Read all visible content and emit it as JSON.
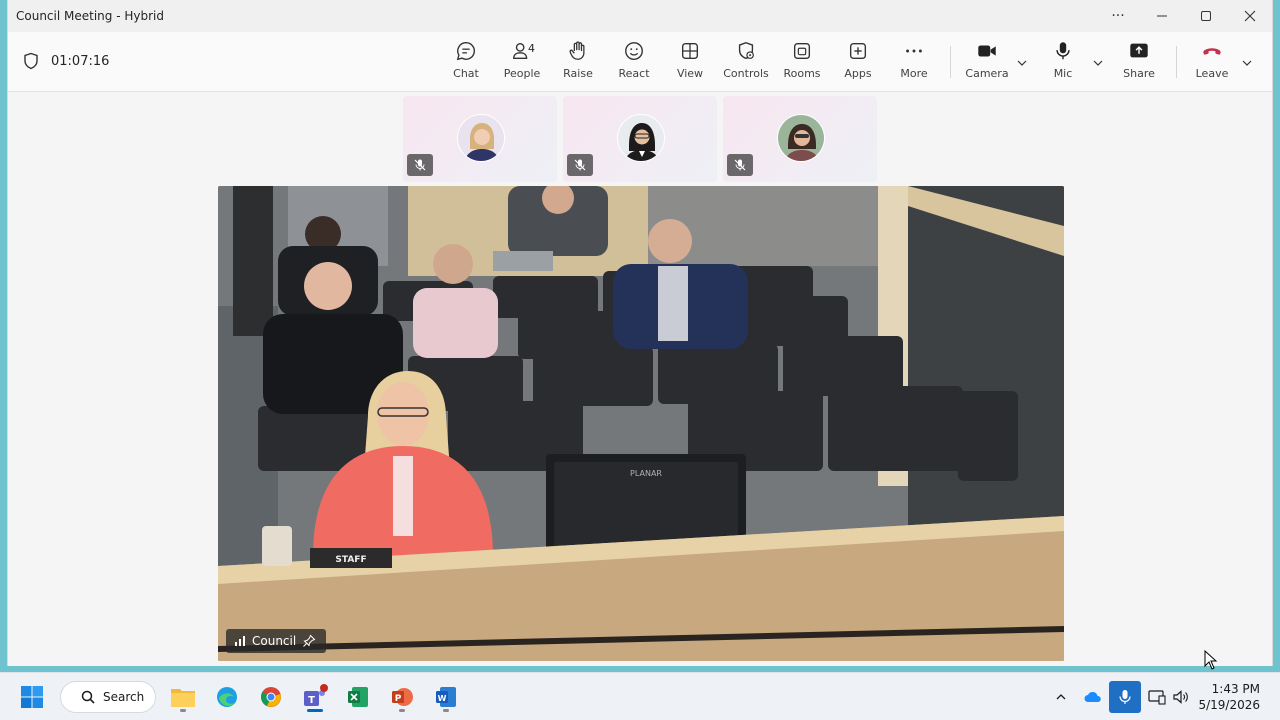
{
  "window": {
    "title": "Council Meeting - Hybrid",
    "more_label": "···"
  },
  "toolbar": {
    "timer": "01:07:16",
    "people_count": "4",
    "buttons": {
      "chat": "Chat",
      "people": "People",
      "raise": "Raise",
      "react": "React",
      "view": "View",
      "controls": "Controls",
      "rooms": "Rooms",
      "apps": "Apps",
      "more": "More",
      "camera": "Camera",
      "mic": "Mic",
      "share": "Share",
      "leave": "Leave"
    }
  },
  "stage": {
    "main_video_label": "Council",
    "placard_text": "STAFF",
    "monitor_text": "PLANAR"
  },
  "taskbar": {
    "search_label": "Search",
    "time": "1:43 PM",
    "date": "5/19/2026"
  },
  "colors": {
    "accent": "#0067c0",
    "leave_red": "#c4314b",
    "teams_purple": "#5b5fc7"
  }
}
